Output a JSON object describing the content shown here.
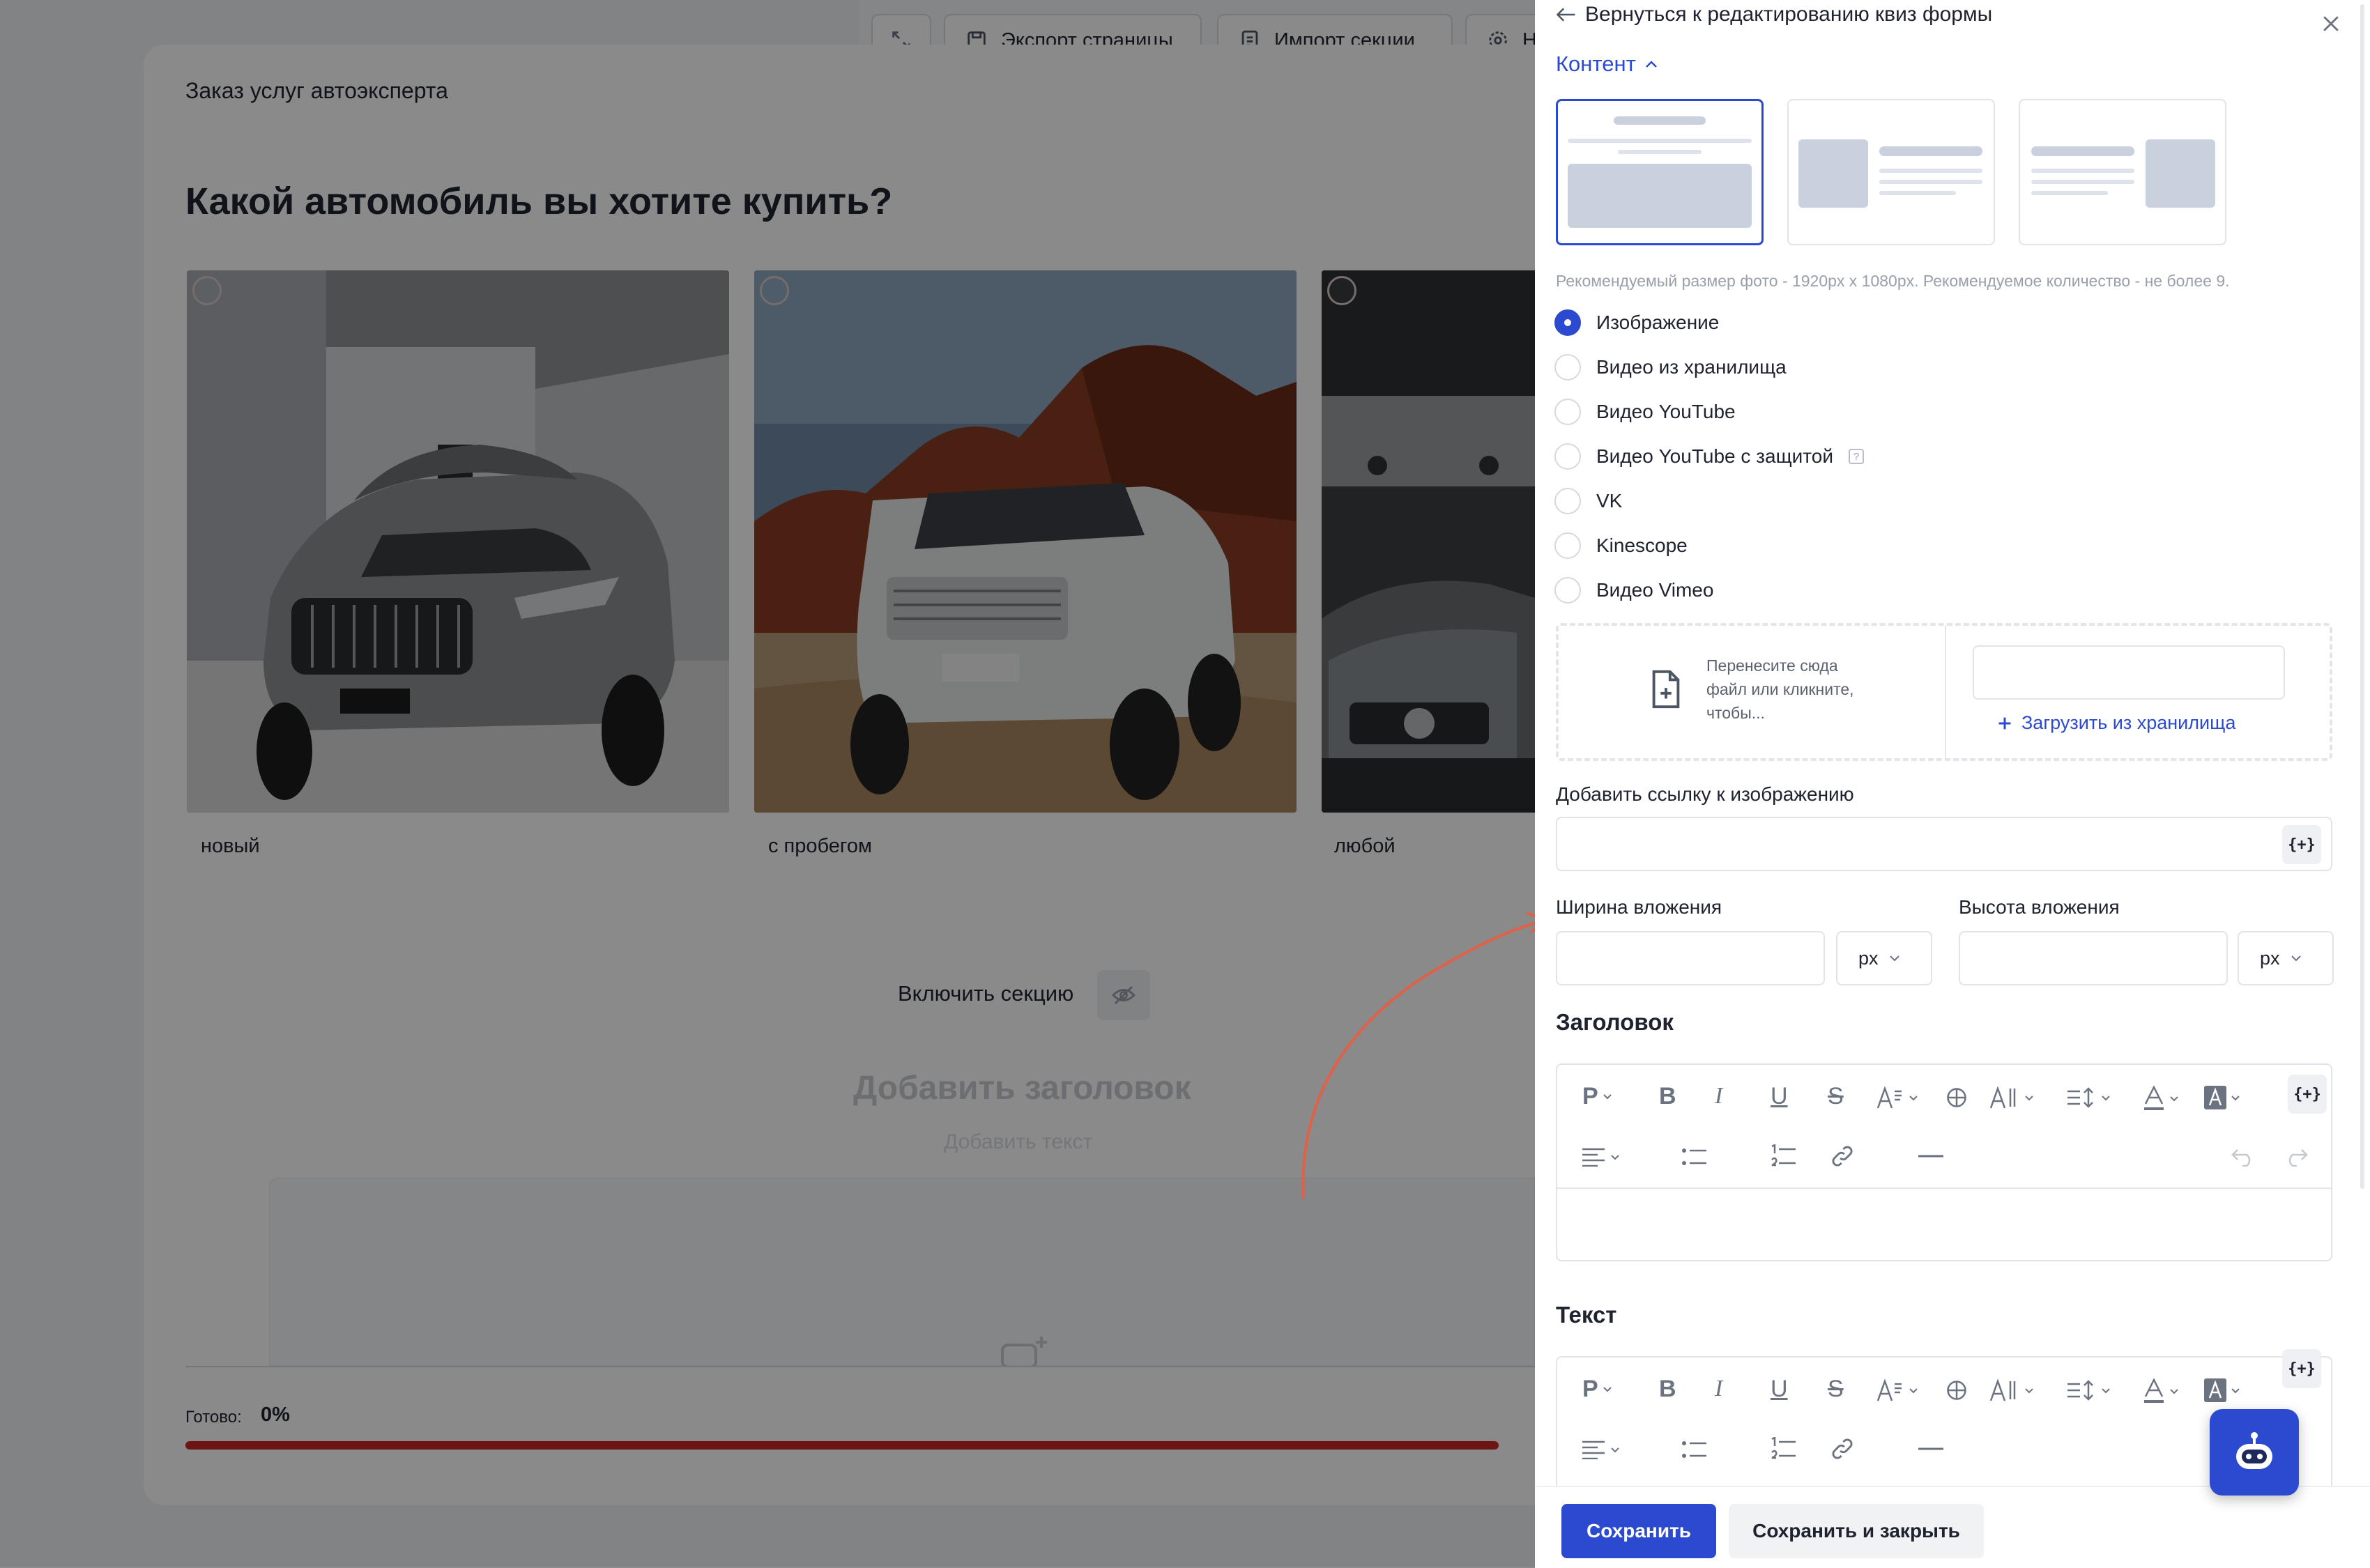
{
  "toolbar": {
    "export_label": "Экспорт страницы",
    "import_label": "Импорт секции",
    "settings_label": "Н"
  },
  "form": {
    "title": "Заказ услуг автоэксперта",
    "question": "Какой автомобиль вы хотите купить?",
    "options": [
      {
        "label": "новый"
      },
      {
        "label": "с пробегом"
      },
      {
        "label": "любой"
      }
    ],
    "include_section_label": "Включить секцию",
    "add_title": "Добавить заголовок",
    "add_text": "Добавить текст",
    "ready_label": "Готово:",
    "ready_value": "0%",
    "progress": 0,
    "progress_color": "#c62828"
  },
  "panel": {
    "back_label": "Вернуться к редактированию квиз формы",
    "section_label": "Контент",
    "layout_selected": 0,
    "hint": "Рекомендуемый размер фото - 1920px x 1080px. Рекомендуемое количество - не более 9.",
    "media_types": [
      {
        "label": "Изображение",
        "selected": true
      },
      {
        "label": "Видео из хранилища",
        "selected": false
      },
      {
        "label": "Видео YouTube",
        "selected": false
      },
      {
        "label": "Видео YouTube с защитой",
        "selected": false,
        "help": "?"
      },
      {
        "label": "VK",
        "selected": false
      },
      {
        "label": "Kinescope",
        "selected": false
      },
      {
        "label": "Видео Vimeo",
        "selected": false
      }
    ],
    "dropzone_text": "Перенесите сюда файл или кликните, чтобы...",
    "upload_link": "Загрузить из хранилища",
    "image_link_label": "Добавить ссылку к изображению",
    "image_link_value": "",
    "variable_button": "{+}",
    "width_label": "Ширина вложения",
    "width_value": "",
    "width_unit": "px",
    "height_label": "Высота вложения",
    "height_value": "",
    "height_unit": "px",
    "heading_label": "Заголовок",
    "text_label": "Текст",
    "editor_tools": {
      "paragraph": "P",
      "bold": "B",
      "italic": "I",
      "underline": "U",
      "strike": "S"
    },
    "save_label": "Сохранить",
    "save_close_label": "Сохранить и закрыть"
  },
  "colors": {
    "accent": "#2c4ad0",
    "overlay": "rgba(0,0,0,0.46)"
  }
}
